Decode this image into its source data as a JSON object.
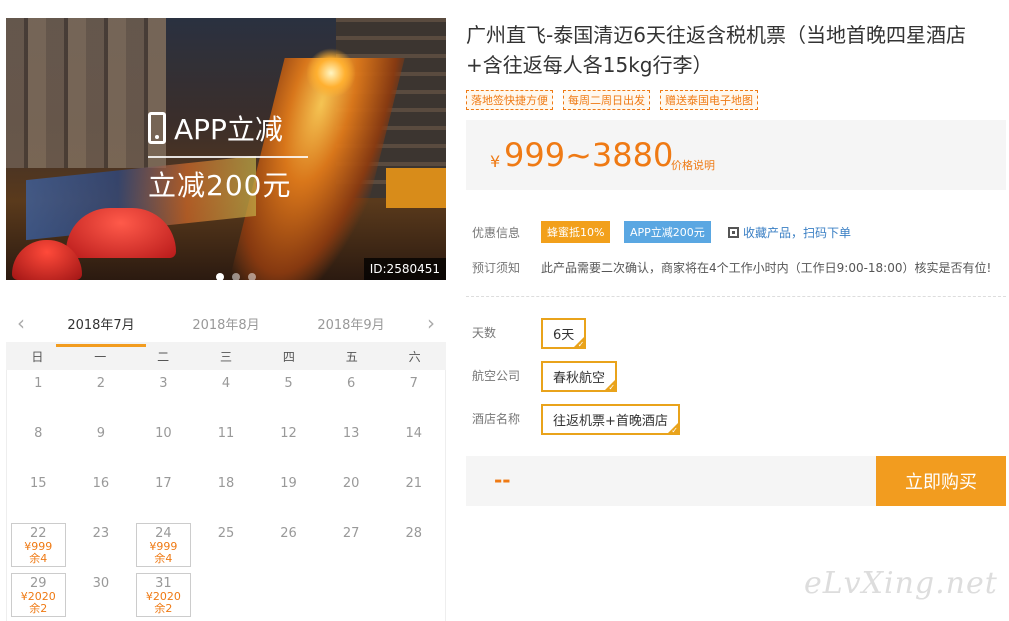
{
  "hero": {
    "promo_line1": "APP立减",
    "promo_line2": "立减200元",
    "id_text": "ID:2580451",
    "dots": 3,
    "active_dot": 0
  },
  "calendar": {
    "prev_icon": "chevron-left-icon",
    "next_icon": "chevron-right-icon",
    "months": [
      "2018年7月",
      "2018年8月",
      "2018年9月"
    ],
    "active_month": 0,
    "weekdays": [
      "日",
      "一",
      "二",
      "三",
      "四",
      "五",
      "六"
    ],
    "days": [
      {
        "d": "1"
      },
      {
        "d": "2"
      },
      {
        "d": "3"
      },
      {
        "d": "4"
      },
      {
        "d": "5"
      },
      {
        "d": "6"
      },
      {
        "d": "7"
      },
      {
        "d": "8"
      },
      {
        "d": "9"
      },
      {
        "d": "10"
      },
      {
        "d": "11"
      },
      {
        "d": "12"
      },
      {
        "d": "13"
      },
      {
        "d": "14"
      },
      {
        "d": "15"
      },
      {
        "d": "16"
      },
      {
        "d": "17"
      },
      {
        "d": "18"
      },
      {
        "d": "19"
      },
      {
        "d": "20"
      },
      {
        "d": "21"
      },
      {
        "d": "22",
        "price": "¥999",
        "remain": "余4"
      },
      {
        "d": "23"
      },
      {
        "d": "24",
        "price": "¥999",
        "remain": "余4"
      },
      {
        "d": "25"
      },
      {
        "d": "26"
      },
      {
        "d": "27"
      },
      {
        "d": "28"
      },
      {
        "d": "29",
        "price": "¥2020",
        "remain": "余2"
      },
      {
        "d": "30"
      },
      {
        "d": "31",
        "price": "¥2020",
        "remain": "余2"
      }
    ]
  },
  "product": {
    "title": "广州直飞-泰国清迈6天往返含税机票（当地首晚四星酒店+含往返每人各15kg行李）",
    "tags": [
      "落地签快捷方便",
      "每周二周日出发",
      "赠送泰国电子地图"
    ],
    "price_currency": "¥",
    "price_range": "999~3880",
    "price_note": "价格说明",
    "discount_label": "优惠信息",
    "discount_badges": [
      "蜂蜜抵10%",
      "APP立减200元"
    ],
    "qr_link": "收藏产品，扫码下单",
    "booking_label": "预订须知",
    "booking_notice": "此产品需要二次确认，商家将在4个工作小时内（工作日9:00-18:00）核实是否有位!",
    "days_label": "天数",
    "days_value": "6天",
    "airline_label": "航空公司",
    "airline_value": "春秋航空",
    "hotel_label": "酒店名称",
    "hotel_value": "往返机票+首晚酒店",
    "total_placeholder": "--",
    "buy_label": "立即购买"
  },
  "watermark": "eLvXing.net",
  "colors": {
    "accent": "#f29c1f",
    "price": "#ef7a14",
    "blue_badge": "#5aa7e2",
    "link": "#3a7fc4"
  }
}
